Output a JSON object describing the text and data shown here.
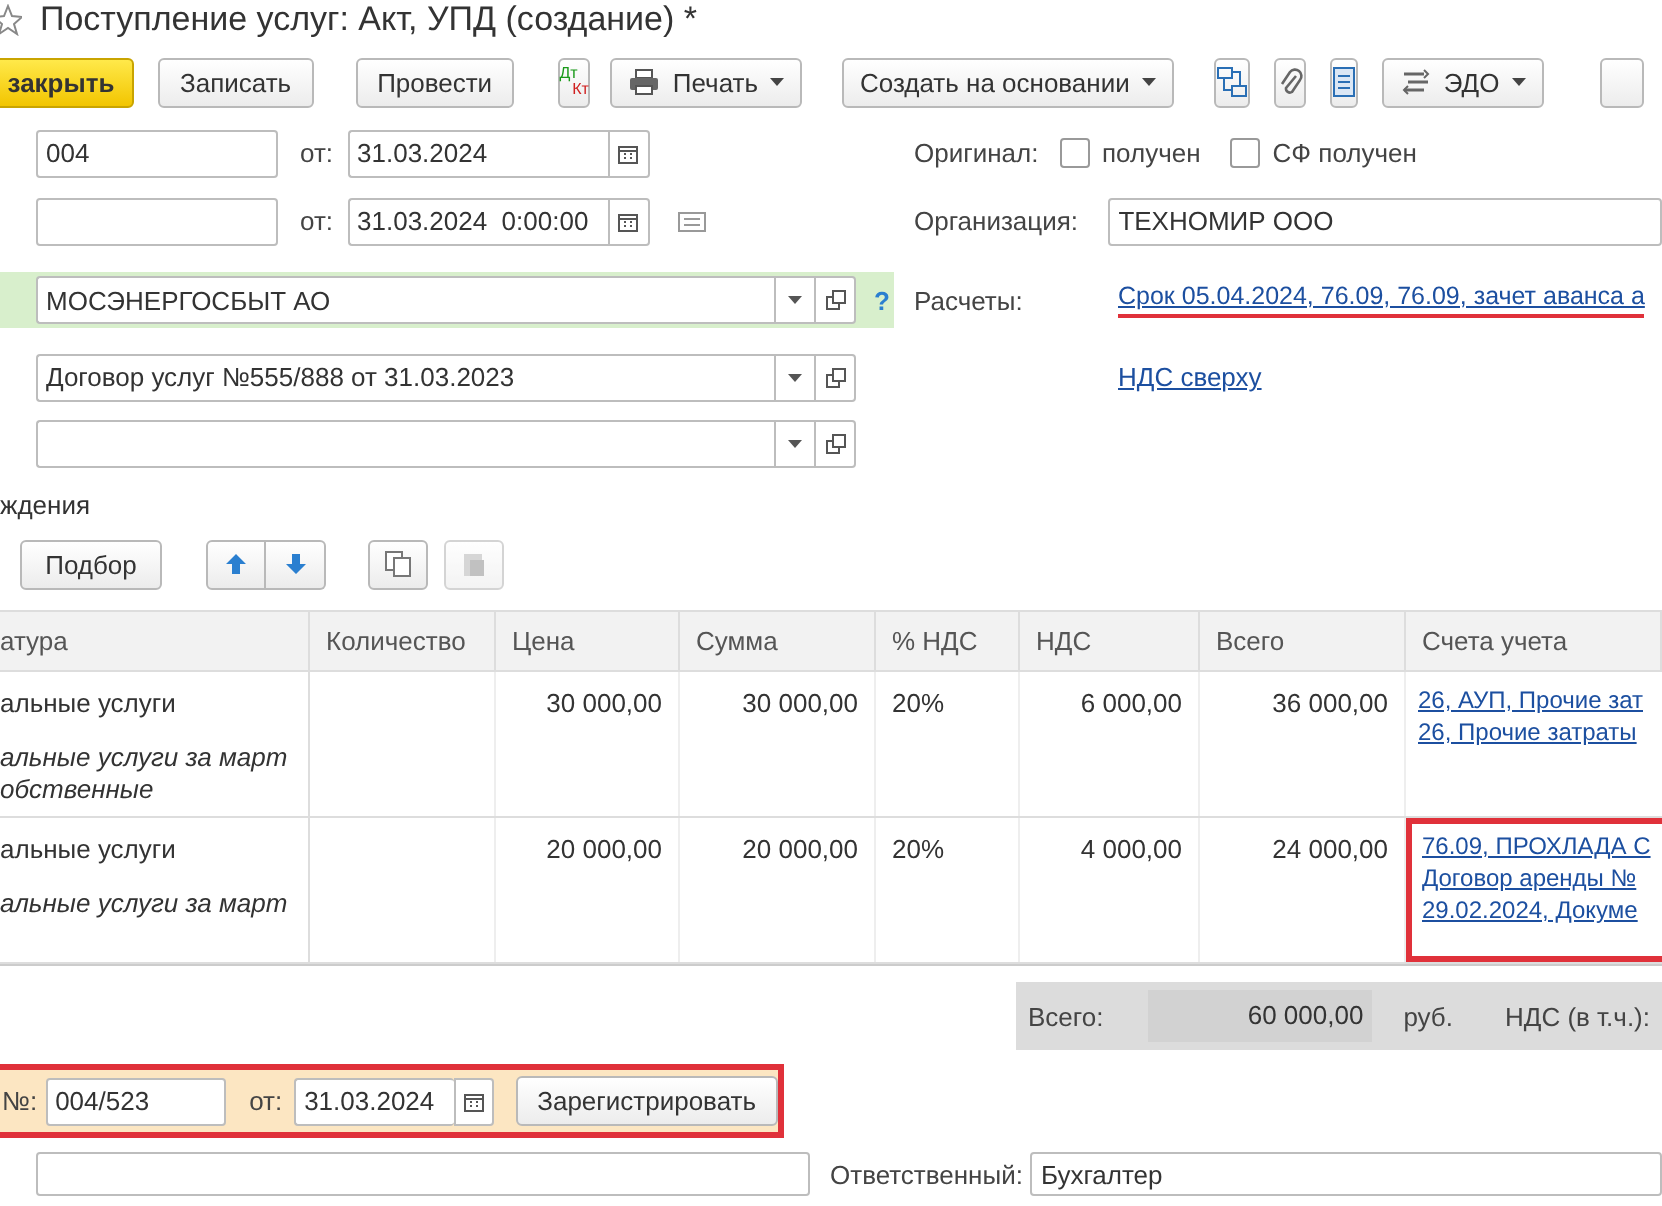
{
  "title": "Поступление услуг: Акт, УПД (создание) *",
  "toolbar": [
    {
      "kind": "primary",
      "label": "закрыть"
    },
    {
      "kind": "text",
      "label": "Записать"
    },
    {
      "kind": "text",
      "label": "Провести"
    },
    {
      "kind": "dtkt",
      "label": "Дт",
      "label2": "Кт"
    },
    {
      "kind": "print",
      "label": "Печать"
    },
    {
      "kind": "menu",
      "label": "Создать на основании"
    },
    {
      "kind": "structure"
    },
    {
      "kind": "clip"
    },
    {
      "kind": "list"
    },
    {
      "kind": "edo",
      "label": "ЭДО"
    },
    {
      "kind": "cut"
    }
  ],
  "number": {
    "value": "004",
    "date_label": "от:",
    "date": "31.03.2024"
  },
  "incoming": {
    "date_label": "от:",
    "date": "31.03.2024  0:00:00"
  },
  "original": {
    "label": "Оригинал:",
    "checks": [
      {
        "label": "получен",
        "checked": false
      },
      {
        "label": "СФ получен",
        "checked": false
      }
    ]
  },
  "organization": {
    "label": "Организация:",
    "value": "ТЕХНОМИР ООО"
  },
  "counterparty": {
    "value": "МОСЭНЕРГОСБЫТ АО",
    "help": "?"
  },
  "settlements": {
    "label": "Расчеты:",
    "link": "Срок 05.04.2024, 76.09, 76.09, зачет аванса а",
    "highlighted": true
  },
  "contract": {
    "value": "Договор услуг №555/888 от 31.03.2023"
  },
  "vat_link": "НДС сверху",
  "section_label": "ждения",
  "table_toolbar": {
    "pick": "Подбор"
  },
  "table": {
    "columns": [
      "атура",
      "Количество",
      "Цена",
      "Сумма",
      "% НДС",
      "НДС",
      "Всего",
      "Счета учета"
    ],
    "rows": [
      {
        "name": "альные услуги",
        "notes": [
          "альные услуги за март",
          "обственные"
        ],
        "price": "30 000,00",
        "sum": "30 000,00",
        "vat_rate": "20%",
        "vat": "6 000,00",
        "total": "36 000,00",
        "accounts": [
          "26, АУП, Прочие зат",
          "26, Прочие затраты"
        ],
        "highlighted": false
      },
      {
        "name": "альные услуги",
        "notes": [
          "альные услуги за март"
        ],
        "price": "20 000,00",
        "sum": "20 000,00",
        "vat_rate": "20%",
        "vat": "4 000,00",
        "total": "24 000,00",
        "accounts": [
          "76.09, ПРОХЛАДА С",
          "Договор аренды №",
          "29.02.2024, Докуме"
        ],
        "highlighted": true
      }
    ]
  },
  "totals": {
    "total_label": "Всего:",
    "total": "60 000,00",
    "currency": "руб.",
    "vat_label": "НДС (в т.ч.):"
  },
  "invoice": {
    "number_label": "№:",
    "number": "004/523",
    "date_label": "от:",
    "date": "31.03.2024",
    "button": "Зарегистрировать",
    "highlighted": true
  },
  "footer": {
    "responsible_label": "Ответственный:",
    "responsible": "Бухгалтер"
  }
}
